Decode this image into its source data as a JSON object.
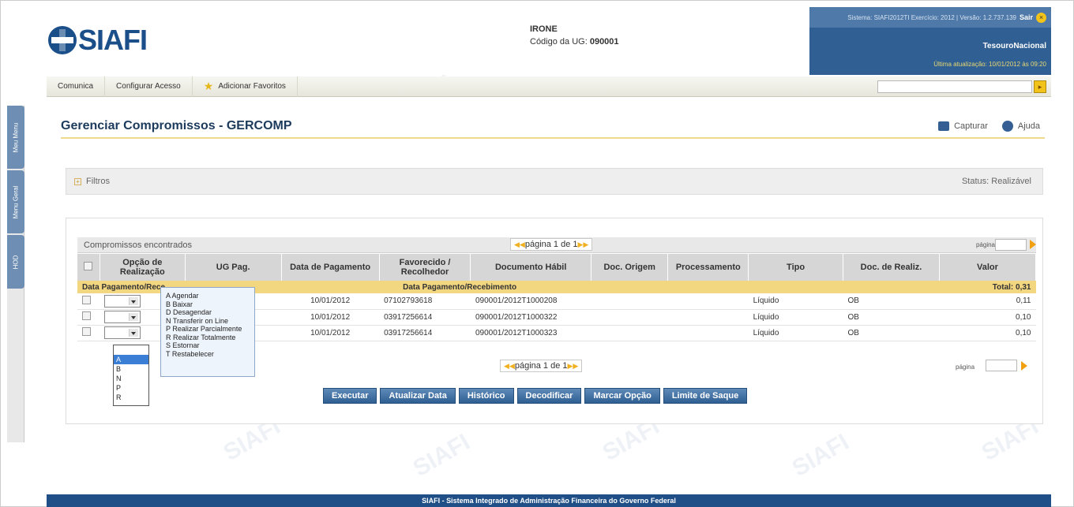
{
  "header": {
    "logo_text": "SIAFI",
    "user_name": "IRONE",
    "ug_label": "Código da UG:",
    "ug_code": "090001",
    "system_info": "Sistema: SIAFI2012TI Exercício: 2012 | Versão: 1.2.737.139",
    "sair_label": "Sair",
    "tesouro_label": "TesouroNacional",
    "last_update": "Última atualização: 10/01/2012 às 09:20"
  },
  "side_tabs": [
    "Meu Menu",
    "Menu Geral",
    "HOD"
  ],
  "menu": {
    "items": [
      "Comunica",
      "Configurar Acesso",
      "Adicionar Favoritos"
    ]
  },
  "page": {
    "title": "Gerenciar Compromissos - GERCOMP",
    "capturar": "Capturar",
    "ajuda": "Ajuda"
  },
  "filters": {
    "label": "Filtros",
    "status": "Status: Realizável"
  },
  "results": {
    "title": "Compromissos encontrados",
    "pager_text": "página 1 de 1",
    "pagina_label": "página",
    "columns": [
      "Opção de Realização",
      "UG Pag.",
      "Data de Pagamento",
      "Favorecido / Recolhedor",
      "Documento Hábil",
      "Doc. Origem",
      "Processamento",
      "Tipo",
      "Doc. de Realiz.",
      "Valor"
    ],
    "group_label_left": "Data Pagamento/Rece",
    "group_label_center": "Data Pagamento/Recebimento",
    "group_total": "Total: 0,31",
    "rows": [
      {
        "data": "10/01/2012",
        "favorecido": "07102793618",
        "documento": "090001/2012T1000208",
        "tipo": "Líquido",
        "doc_realiz": "OB",
        "valor": "0,11"
      },
      {
        "data": "10/01/2012",
        "favorecido": "03917256614",
        "documento": "090001/2012T1000322",
        "tipo": "Líquido",
        "doc_realiz": "OB",
        "valor": "0,10"
      },
      {
        "data": "10/01/2012",
        "favorecido": "03917256614",
        "documento": "090001/2012T1000323",
        "tipo": "Líquido",
        "doc_realiz": "OB",
        "valor": "0,10"
      }
    ]
  },
  "legend": [
    "A Agendar",
    "B Baixar",
    "D Desagendar",
    "N Transferir on Line",
    "P Realizar Parcialmente",
    "R Realizar Totalmente",
    "S Estornar",
    "T Restabelecer"
  ],
  "dropdown_options": [
    "A",
    "B",
    "N",
    "P",
    "R"
  ],
  "buttons": [
    "Executar",
    "Atualizar Data",
    "Histórico",
    "Decodificar",
    "Marcar Opção",
    "Limite de Saque"
  ],
  "footer": "SIAFI - Sistema Integrado de Administração Financeira do Governo Federal"
}
